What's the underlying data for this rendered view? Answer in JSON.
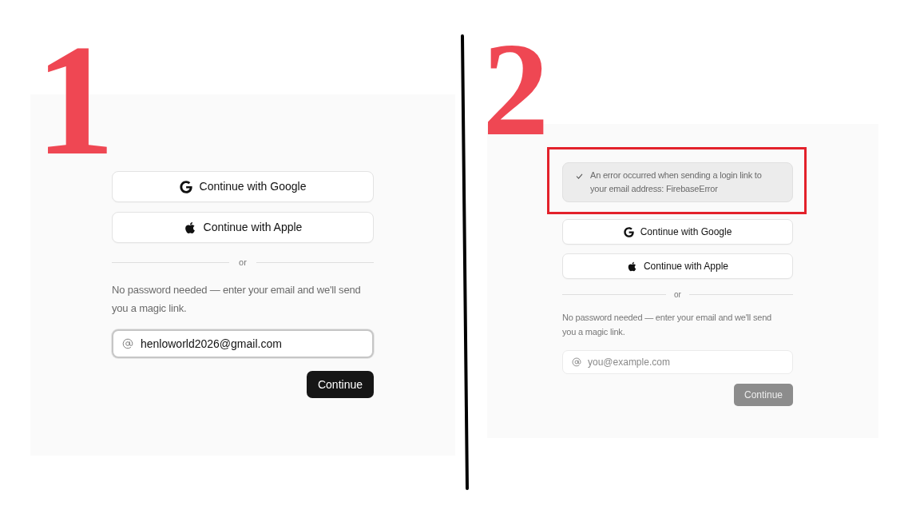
{
  "panels": [
    {
      "label": "1",
      "buttons": [
        {
          "kind": "google",
          "label": "Continue with Google"
        },
        {
          "kind": "apple",
          "label": "Continue with Apple"
        }
      ],
      "divider": "or",
      "hint": "No password needed — enter your email and we'll send you a magic link.",
      "email": {
        "value": "henloworld2026@gmail.com",
        "focused": true
      },
      "submit": {
        "label": "Continue",
        "disabled": false
      }
    },
    {
      "label": "2",
      "alert": {
        "text": "An error occurred when sending a login link to your email address: FirebaseError",
        "highlighted": true
      },
      "buttons": [
        {
          "kind": "google",
          "label": "Continue with Google"
        },
        {
          "kind": "apple",
          "label": "Continue with Apple"
        }
      ],
      "divider": "or",
      "hint": "No password needed — enter your email and we'll send you a magic link.",
      "email": {
        "placeholder": "you@example.com",
        "focused": false
      },
      "submit": {
        "label": "Continue",
        "disabled": true
      }
    }
  ]
}
